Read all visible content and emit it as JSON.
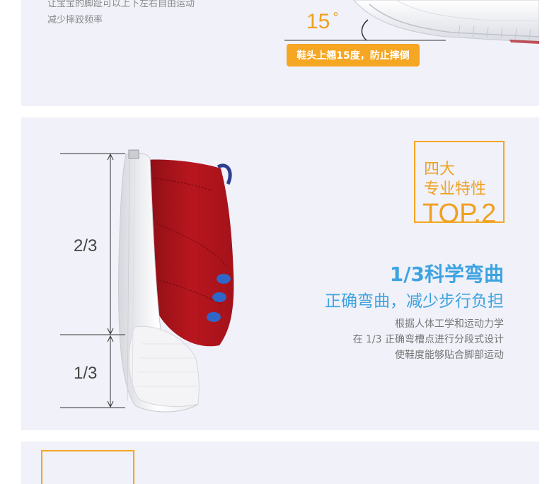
{
  "section1": {
    "lines": [
      "让宝宝的脚趾可以上下左右自由运动",
      "减少摔跤频率"
    ],
    "angle_value": "15",
    "angle_unit": "°",
    "tag_text": "鞋头上翘15度，防止摔倒"
  },
  "section2": {
    "badge": {
      "line1": "四大",
      "line2": "专业特性",
      "line3": "TOP.2"
    },
    "heading": "1/3科学弯曲",
    "subheading": "正确弯曲，减少步行负担",
    "desc": [
      "根据人体工学和运动力学",
      "在 1/3 正确弯槽点进行分段式设计",
      "使鞋度能够贴合脚部运动"
    ],
    "ratio_top": "2/3",
    "ratio_bottom": "1/3"
  },
  "colors": {
    "panel_bg": "#f0f1f9",
    "accent_orange": "#f5a623",
    "accent_blue": "#3da3e0",
    "shoe_red": "#b0141b",
    "sole_white": "#f4f4f4"
  }
}
